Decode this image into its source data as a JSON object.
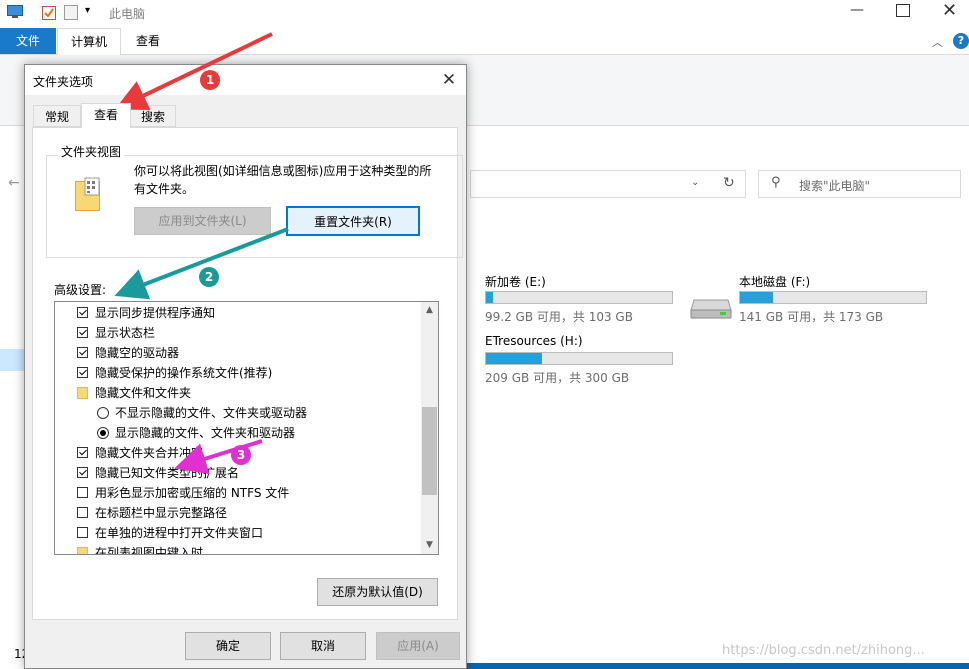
{
  "explorer": {
    "title": "此电脑",
    "tabs": [
      "文件",
      "计算机",
      "查看"
    ],
    "search_placeholder": "搜索\"此电脑\"",
    "left_partial": "12",
    "drives": [
      {
        "name": "新加卷 (E:)",
        "info": "99.2 GB 可用，共 103 GB",
        "used_fraction": 0.04
      },
      {
        "name": "本地磁盘 (F:)",
        "info": "141 GB 可用，共 173 GB",
        "used_fraction": 0.18
      },
      {
        "name": "ETresources (H:)",
        "info": "209 GB 可用，共 300 GB",
        "used_fraction": 0.3
      }
    ],
    "watermark": "https://blog.csdn.net/zhihong..."
  },
  "dialog": {
    "title": "文件夹选项",
    "tabs": [
      "常规",
      "查看",
      "搜索"
    ],
    "folder_views": {
      "label": "文件夹视图",
      "description": "你可以将此视图(如详细信息或图标)应用于这种类型的所有文件夹。",
      "apply_button": "应用到文件夹(L)",
      "reset_button": "重置文件夹(R)"
    },
    "advanced_label": "高级设置:",
    "advanced_items": [
      {
        "type": "check",
        "checked": true,
        "indent": 0,
        "label": "显示同步提供程序通知"
      },
      {
        "type": "check",
        "checked": true,
        "indent": 0,
        "label": "显示状态栏"
      },
      {
        "type": "check",
        "checked": true,
        "indent": 0,
        "label": "隐藏空的驱动器"
      },
      {
        "type": "check",
        "checked": true,
        "indent": 0,
        "label": "隐藏受保护的操作系统文件(推荐)"
      },
      {
        "type": "folder",
        "checked": false,
        "indent": 0,
        "label": "隐藏文件和文件夹"
      },
      {
        "type": "radio",
        "checked": false,
        "indent": 1,
        "label": "不显示隐藏的文件、文件夹或驱动器"
      },
      {
        "type": "radio",
        "checked": true,
        "indent": 1,
        "label": "显示隐藏的文件、文件夹和驱动器"
      },
      {
        "type": "check",
        "checked": true,
        "indent": 0,
        "label": "隐藏文件夹合并冲突"
      },
      {
        "type": "check",
        "checked": true,
        "indent": 0,
        "label": "隐藏已知文件类型的扩展名"
      },
      {
        "type": "check",
        "checked": false,
        "indent": 0,
        "label": "用彩色显示加密或压缩的 NTFS 文件"
      },
      {
        "type": "check",
        "checked": false,
        "indent": 0,
        "label": "在标题栏中显示完整路径"
      },
      {
        "type": "check",
        "checked": false,
        "indent": 0,
        "label": "在单独的进程中打开文件夹窗口"
      },
      {
        "type": "folder",
        "checked": false,
        "indent": 0,
        "label": "在列表视图中键入时"
      }
    ],
    "restore_button": "还原为默认值(D)",
    "ok_button": "确定",
    "cancel_button": "取消",
    "apply_button": "应用(A)"
  },
  "annotations": {
    "badges": [
      "1",
      "2",
      "3"
    ],
    "colors": {
      "red": "#e8393b",
      "teal": "#1a9a9a",
      "magenta": "#e030d0"
    }
  }
}
